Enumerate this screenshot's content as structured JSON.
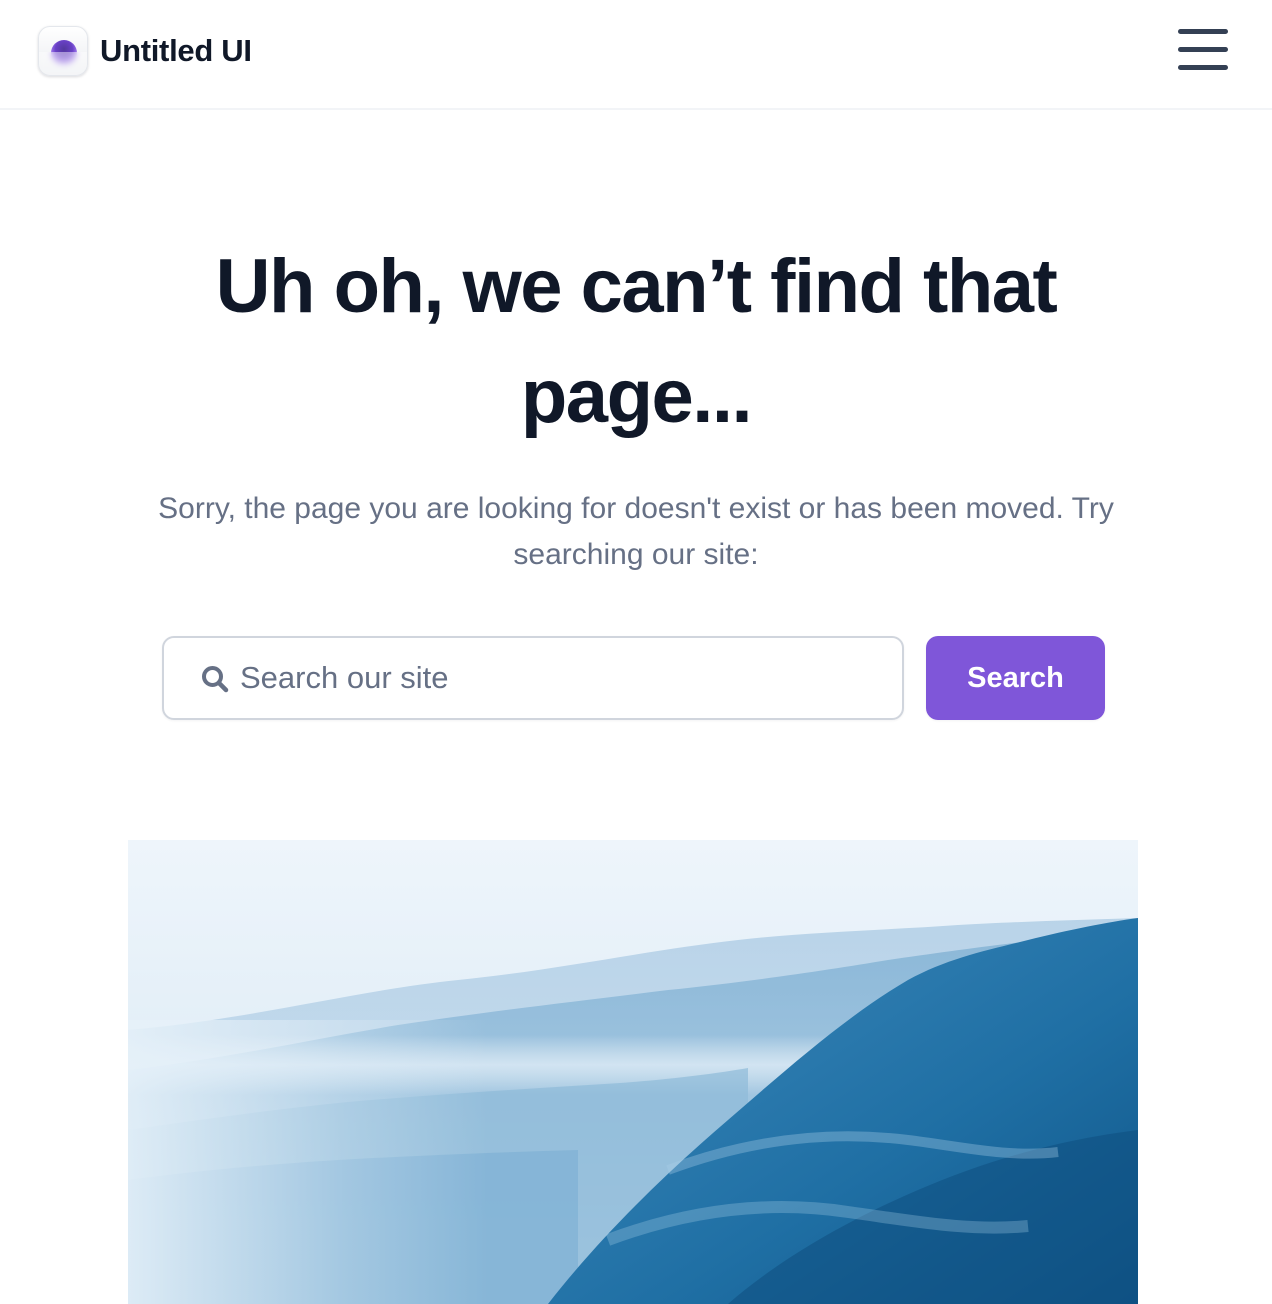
{
  "header": {
    "brand_name": "Untitled UI",
    "logo_icon": "logo-mark",
    "menu_icon": "hamburger-menu-icon"
  },
  "main": {
    "title": "Uh oh, we can’t find that page...",
    "subtitle": "Sorry, the page you are looking for doesn't exist or has been moved. Try searching our site:",
    "search": {
      "placeholder": "Search our site",
      "value": "",
      "icon": "search-icon",
      "button_label": "Search"
    }
  },
  "colors": {
    "accent": "#7f56d9",
    "heading": "#101828",
    "body_text": "#667085",
    "border": "#d0d5dd"
  },
  "image": {
    "description_icon": "misty-mountains-image"
  }
}
